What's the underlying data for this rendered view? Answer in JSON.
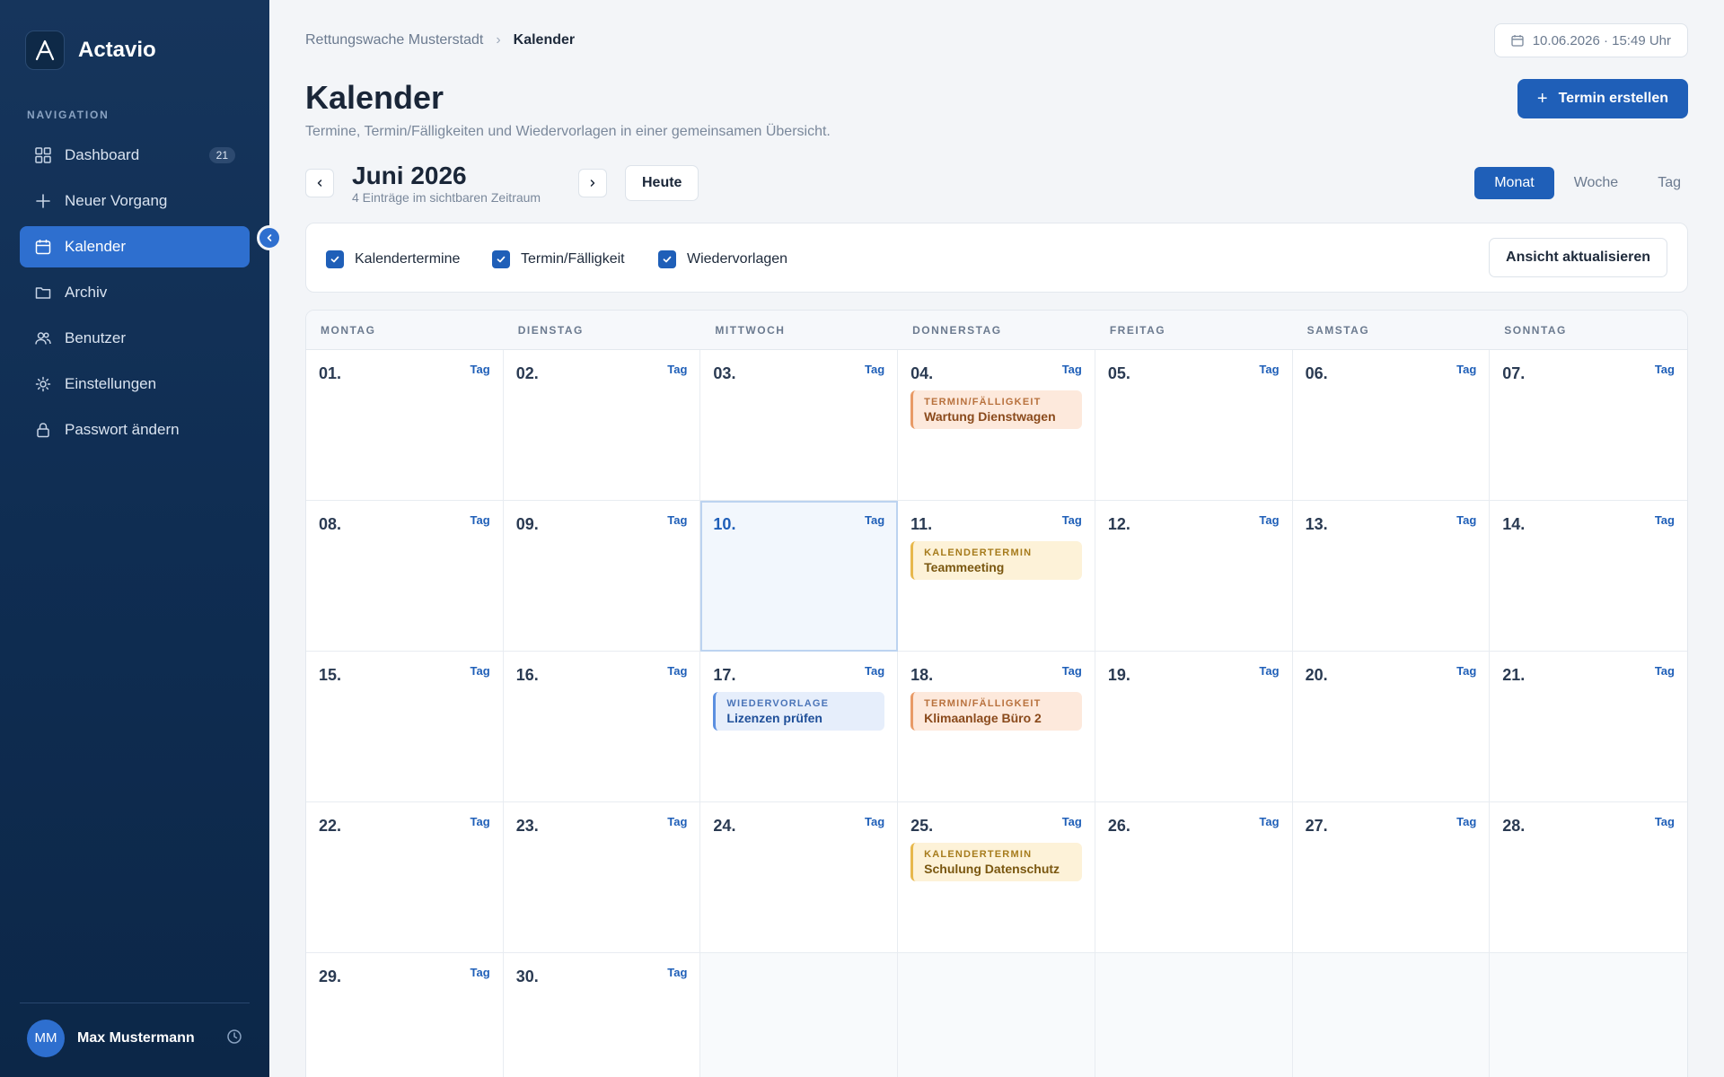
{
  "app": {
    "name": "Actavio"
  },
  "sidebar": {
    "heading": "NAVIGATION",
    "items": [
      {
        "label": "Dashboard",
        "icon": "grid-icon",
        "badge": "21"
      },
      {
        "label": "Neuer Vorgang",
        "icon": "plus-icon"
      },
      {
        "label": "Kalender",
        "icon": "calendar-icon",
        "active": true
      },
      {
        "label": "Archiv",
        "icon": "folder-icon"
      },
      {
        "label": "Benutzer",
        "icon": "users-icon"
      },
      {
        "label": "Einstellungen",
        "icon": "gear-icon"
      },
      {
        "label": "Passwort ändern",
        "icon": "lock-icon"
      }
    ],
    "user": {
      "initials": "MM",
      "name": "Max Mustermann"
    }
  },
  "header": {
    "breadcrumb": [
      "Rettungswache Musterstadt",
      "Kalender"
    ],
    "datetime": "10.06.2026 · 15:49 Uhr",
    "title": "Kalender",
    "subtitle": "Termine, Termin/Fälligkeiten und Wiedervorlagen in einer gemeinsamen Übersicht.",
    "create_label": "Termin erstellen"
  },
  "month_nav": {
    "title": "Juni 2026",
    "count": "4 Einträge im sichtbaren Zeitraum",
    "today_label": "Heute"
  },
  "views": [
    "Monat",
    "Woche",
    "Tag"
  ],
  "active_view": "Monat",
  "filters": [
    {
      "label": "Kalendertermine",
      "checked": true
    },
    {
      "label": "Termin/Fälligkeit",
      "checked": true
    },
    {
      "label": "Wiedervorlagen",
      "checked": true
    }
  ],
  "refresh_label": "Ansicht aktualisieren",
  "calendar": {
    "weekdays": [
      "MONTAG",
      "DIENSTAG",
      "MITTWOCH",
      "DONNERSTAG",
      "FREITAG",
      "SAMSTAG",
      "SONNTAG"
    ],
    "day_link_label": "Tag",
    "today": "10.",
    "days": [
      "01.",
      "02.",
      "03.",
      "04.",
      "05.",
      "06.",
      "07.",
      "08.",
      "09.",
      "10.",
      "11.",
      "12.",
      "13.",
      "14.",
      "15.",
      "16.",
      "17.",
      "18.",
      "19.",
      "20.",
      "21.",
      "22.",
      "23.",
      "24.",
      "25.",
      "26.",
      "27.",
      "28.",
      "29.",
      "30."
    ],
    "events": [
      {
        "day": "04.",
        "kind": "termin",
        "type": "TERMIN/FÄLLIGKEIT",
        "title": "Wartung Dienstwagen"
      },
      {
        "day": "11.",
        "kind": "kalender",
        "type": "KALENDERTERMIN",
        "title": "Teammeeting"
      },
      {
        "day": "17.",
        "kind": "wieder",
        "type": "WIEDERVORLAGE",
        "title": "Lizenzen prüfen"
      },
      {
        "day": "18.",
        "kind": "termin",
        "type": "TERMIN/FÄLLIGKEIT",
        "title": "Klimaanlage Büro 2"
      },
      {
        "day": "25.",
        "kind": "kalender",
        "type": "KALENDERTERMIN",
        "title": "Schulung Datenschutz"
      }
    ],
    "colors": {
      "accent": "#1f5fb8",
      "termin": "#e89a66",
      "kalender": "#e7b84c",
      "wieder": "#5b8fe0"
    }
  }
}
